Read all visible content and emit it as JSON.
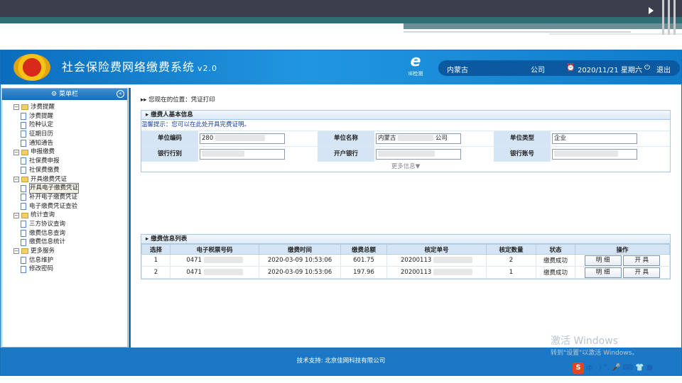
{
  "app": {
    "title": "社会保险费网络缴费系统",
    "version": "v2.0",
    "ie_label": "IE检测",
    "org": "内蒙古",
    "company_suffix": "公司",
    "datetime": "2020/11/21 星期六",
    "logout": "退出"
  },
  "sidebar": {
    "title": "菜单栏",
    "groups": [
      {
        "label": "涉费提醒",
        "items": [
          "涉费提醒",
          "险种认定",
          "征期日历",
          "通知通告"
        ]
      },
      {
        "label": "申报缴费",
        "items": [
          "社保费申报",
          "社保费缴费"
        ]
      },
      {
        "label": "开具缴费凭证",
        "items": [
          "开具电子缴费凭证",
          "补开电子缴费凭证",
          "电子缴费凭证查验"
        ]
      },
      {
        "label": "统计查询",
        "items": [
          "三方协议查询",
          "缴费信息查询",
          "缴费信息统计"
        ]
      },
      {
        "label": "更多服务",
        "items": [
          "信息维护",
          "修改密码"
        ]
      }
    ]
  },
  "main": {
    "breadcrumb": "您现在的位置：凭证打印",
    "basic": {
      "title": "缴费人基本信息",
      "tip": "温馨提示：您可以在此处开具完费证明。",
      "fields": {
        "unit_code_label": "单位编码",
        "unit_code": "280",
        "unit_name_label": "单位名称",
        "unit_name": "内蒙古",
        "unit_name_suffix": "公司",
        "unit_type_label": "单位类型",
        "unit_type": "企业",
        "bank_label": "银行行别",
        "open_bank_label": "开户银行",
        "account_label": "银行账号"
      },
      "more": "更多信息▼"
    },
    "list": {
      "title": "缴费信息列表",
      "headers": [
        "选择",
        "电子税票号码",
        "缴费时间",
        "缴费总额",
        "核定单号",
        "核定数量",
        "状态",
        "操作"
      ],
      "rows": [
        {
          "sel": "1",
          "ticket": "0471",
          "time": "2020-03-09 10:53:06",
          "total": "601.75",
          "order": "20200113",
          "qty": "2",
          "status": "缴费成功"
        },
        {
          "sel": "2",
          "ticket": "0471",
          "time": "2020-03-09 10:53:06",
          "total": "197.96",
          "order": "20200113",
          "qty": "1",
          "status": "缴费成功"
        }
      ],
      "btn_detail": "明 细",
      "btn_issue": "开 具"
    }
  },
  "footer": "技术支持: 北京佳网科技有限公司",
  "watermark": {
    "line1": "激活 Windows",
    "line2": "转到\"设置\"以激活 Windows。"
  },
  "ime": {
    "logo": "S",
    "mode": "中"
  }
}
